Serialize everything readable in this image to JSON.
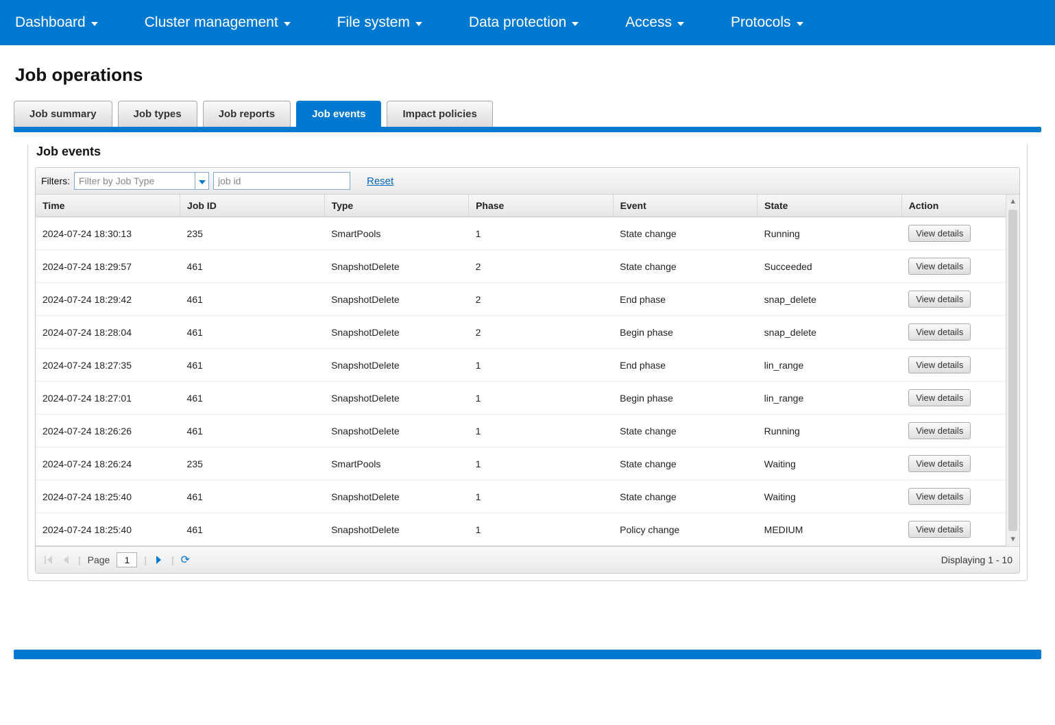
{
  "nav": {
    "items": [
      {
        "label": "Dashboard"
      },
      {
        "label": "Cluster management"
      },
      {
        "label": "File system"
      },
      {
        "label": "Data protection"
      },
      {
        "label": "Access"
      },
      {
        "label": "Protocols"
      }
    ]
  },
  "page": {
    "title": "Job operations"
  },
  "tabs": [
    {
      "label": "Job summary",
      "active": false
    },
    {
      "label": "Job types",
      "active": false
    },
    {
      "label": "Job reports",
      "active": false
    },
    {
      "label": "Job events",
      "active": true
    },
    {
      "label": "Impact policies",
      "active": false
    }
  ],
  "section": {
    "title": "Job events"
  },
  "filters": {
    "label": "Filters:",
    "type_placeholder": "Filter by Job Type",
    "jobid_placeholder": "job id",
    "reset_label": "Reset"
  },
  "columns": {
    "time": "Time",
    "job_id": "Job ID",
    "type": "Type",
    "phase": "Phase",
    "event": "Event",
    "state": "State",
    "action": "Action"
  },
  "action_button_label": "View details",
  "rows": [
    {
      "time": "2024-07-24 18:30:13",
      "job_id": "235",
      "type": "SmartPools",
      "phase": "1",
      "event": "State change",
      "state": "Running"
    },
    {
      "time": "2024-07-24 18:29:57",
      "job_id": "461",
      "type": "SnapshotDelete",
      "phase": "2",
      "event": "State change",
      "state": "Succeeded"
    },
    {
      "time": "2024-07-24 18:29:42",
      "job_id": "461",
      "type": "SnapshotDelete",
      "phase": "2",
      "event": "End phase",
      "state": "snap_delete"
    },
    {
      "time": "2024-07-24 18:28:04",
      "job_id": "461",
      "type": "SnapshotDelete",
      "phase": "2",
      "event": "Begin phase",
      "state": "snap_delete"
    },
    {
      "time": "2024-07-24 18:27:35",
      "job_id": "461",
      "type": "SnapshotDelete",
      "phase": "1",
      "event": "End phase",
      "state": "lin_range"
    },
    {
      "time": "2024-07-24 18:27:01",
      "job_id": "461",
      "type": "SnapshotDelete",
      "phase": "1",
      "event": "Begin phase",
      "state": "lin_range"
    },
    {
      "time": "2024-07-24 18:26:26",
      "job_id": "461",
      "type": "SnapshotDelete",
      "phase": "1",
      "event": "State change",
      "state": "Running"
    },
    {
      "time": "2024-07-24 18:26:24",
      "job_id": "235",
      "type": "SmartPools",
      "phase": "1",
      "event": "State change",
      "state": "Waiting"
    },
    {
      "time": "2024-07-24 18:25:40",
      "job_id": "461",
      "type": "SnapshotDelete",
      "phase": "1",
      "event": "State change",
      "state": "Waiting"
    },
    {
      "time": "2024-07-24 18:25:40",
      "job_id": "461",
      "type": "SnapshotDelete",
      "phase": "1",
      "event": "Policy change",
      "state": "MEDIUM"
    }
  ],
  "pager": {
    "page_label": "Page",
    "current_page": "1",
    "status": "Displaying 1 - 10"
  }
}
